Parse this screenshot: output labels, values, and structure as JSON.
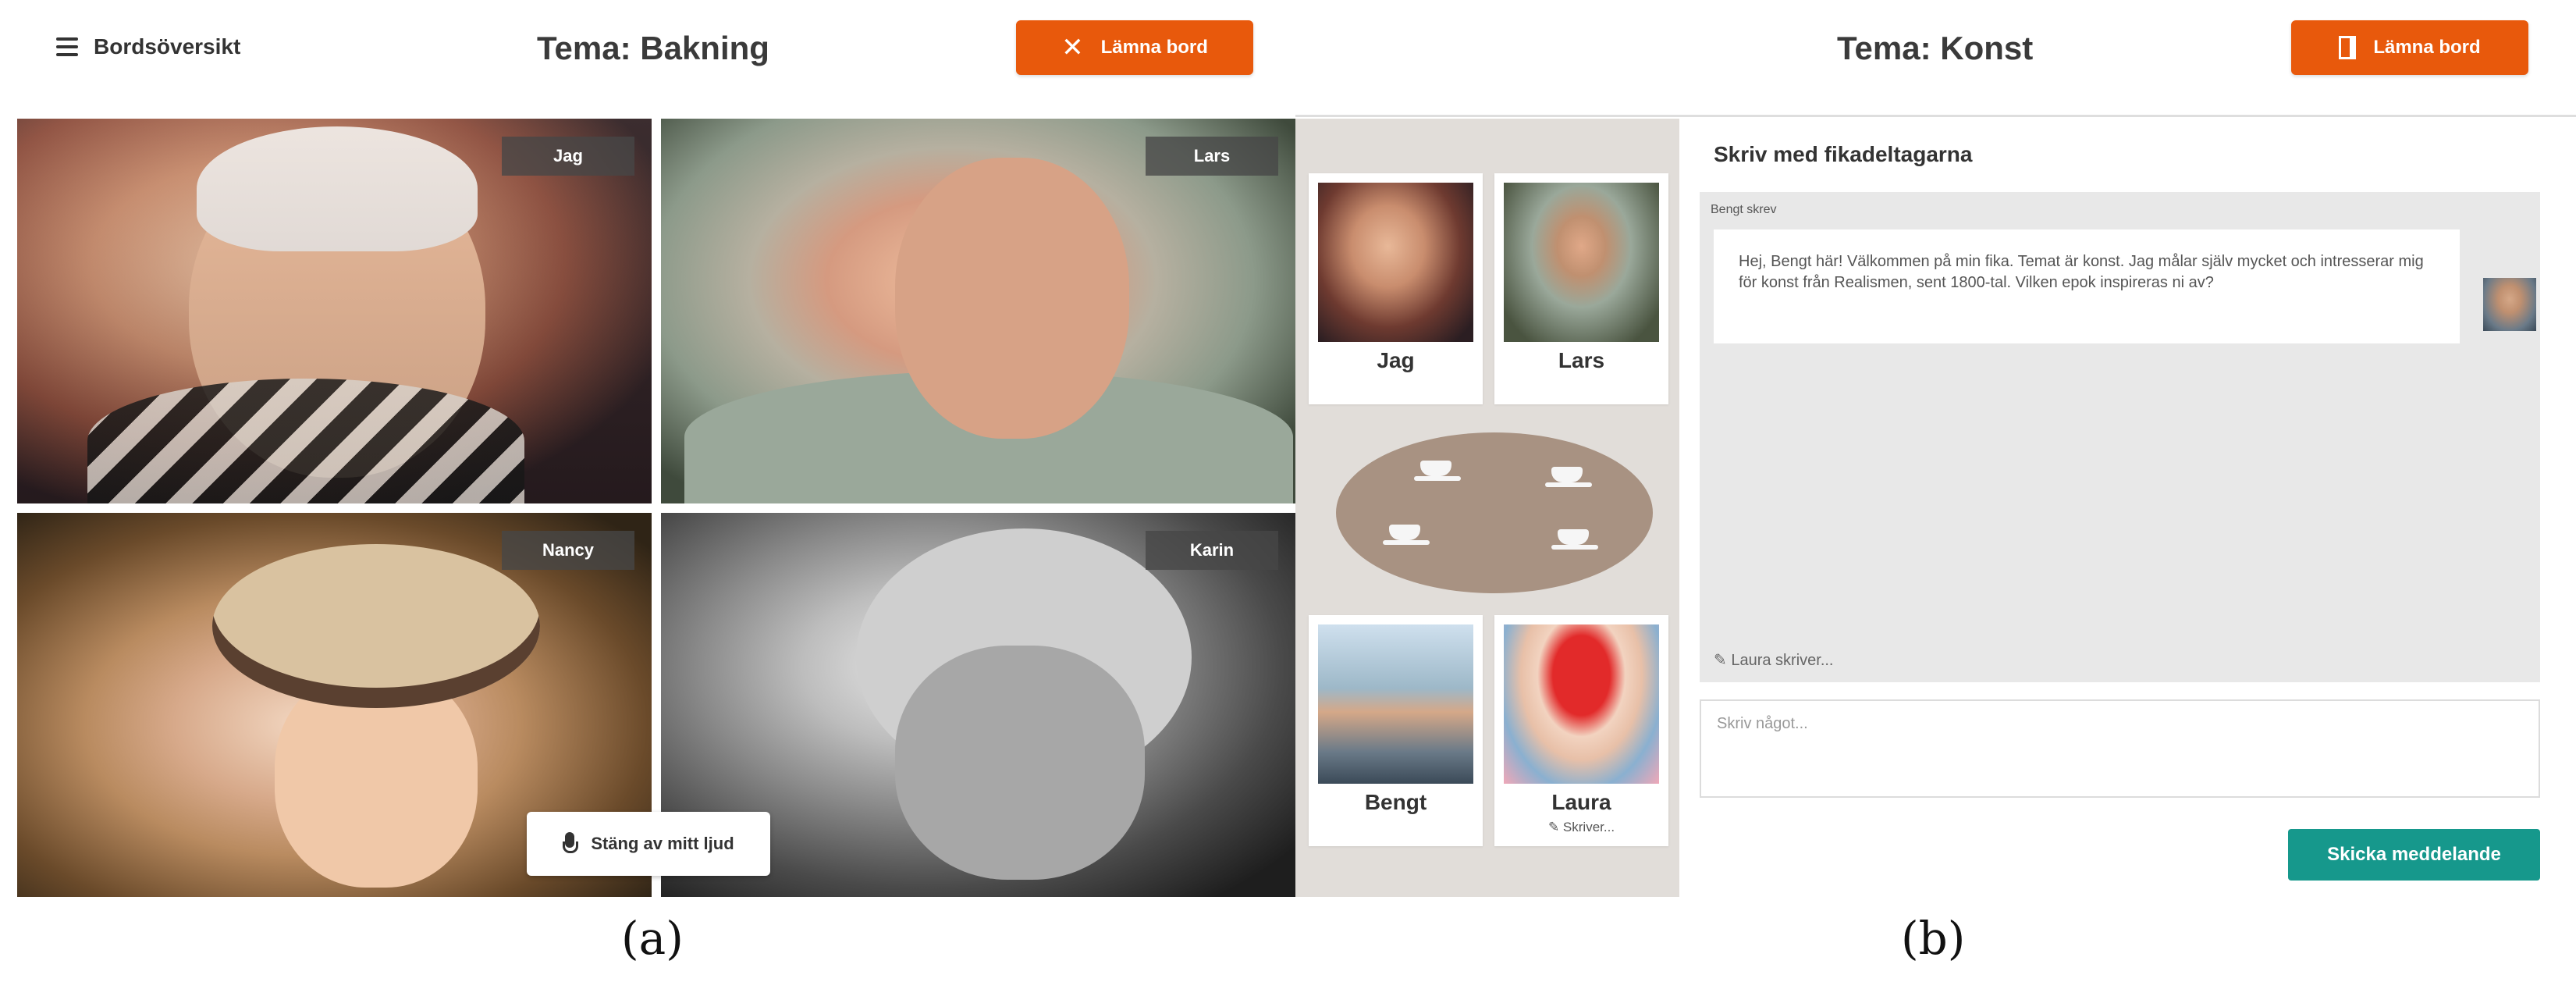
{
  "panel_a": {
    "menu_label": "Bordsöversikt",
    "title": "Tema: Bakning",
    "leave_label": "Lämna bord",
    "participants": [
      "Jag",
      "Lars",
      "Nancy",
      "Karin"
    ],
    "mute_label": "Stäng av mitt ljud",
    "caption": "(a)"
  },
  "panel_b": {
    "title": "Tema: Konst",
    "leave_label": "Lämna bord",
    "cards": [
      {
        "name": "Jag"
      },
      {
        "name": "Lars"
      },
      {
        "name": "Bengt"
      },
      {
        "name": "Laura",
        "status": "Skriver..."
      }
    ],
    "chat": {
      "title": "Skriv med fikadeltagarna",
      "message_author": "Bengt skrev",
      "message_text": "Hej, Bengt här! Välkommen på min fika. Temat är konst. Jag målar själv mycket och intresserar mig för konst från Realismen, sent 1800-tal. Vilken epok inspireras ni av?",
      "typing_indicator": "Laura skriver...",
      "input_placeholder": "Skriv något...",
      "send_label": "Skicka meddelande"
    },
    "caption": "(b)"
  },
  "colors": {
    "accent_orange": "#e8590c",
    "send_teal": "#16988c",
    "table_brown": "#a89282",
    "table_area_bg": "#e1ddd9"
  }
}
